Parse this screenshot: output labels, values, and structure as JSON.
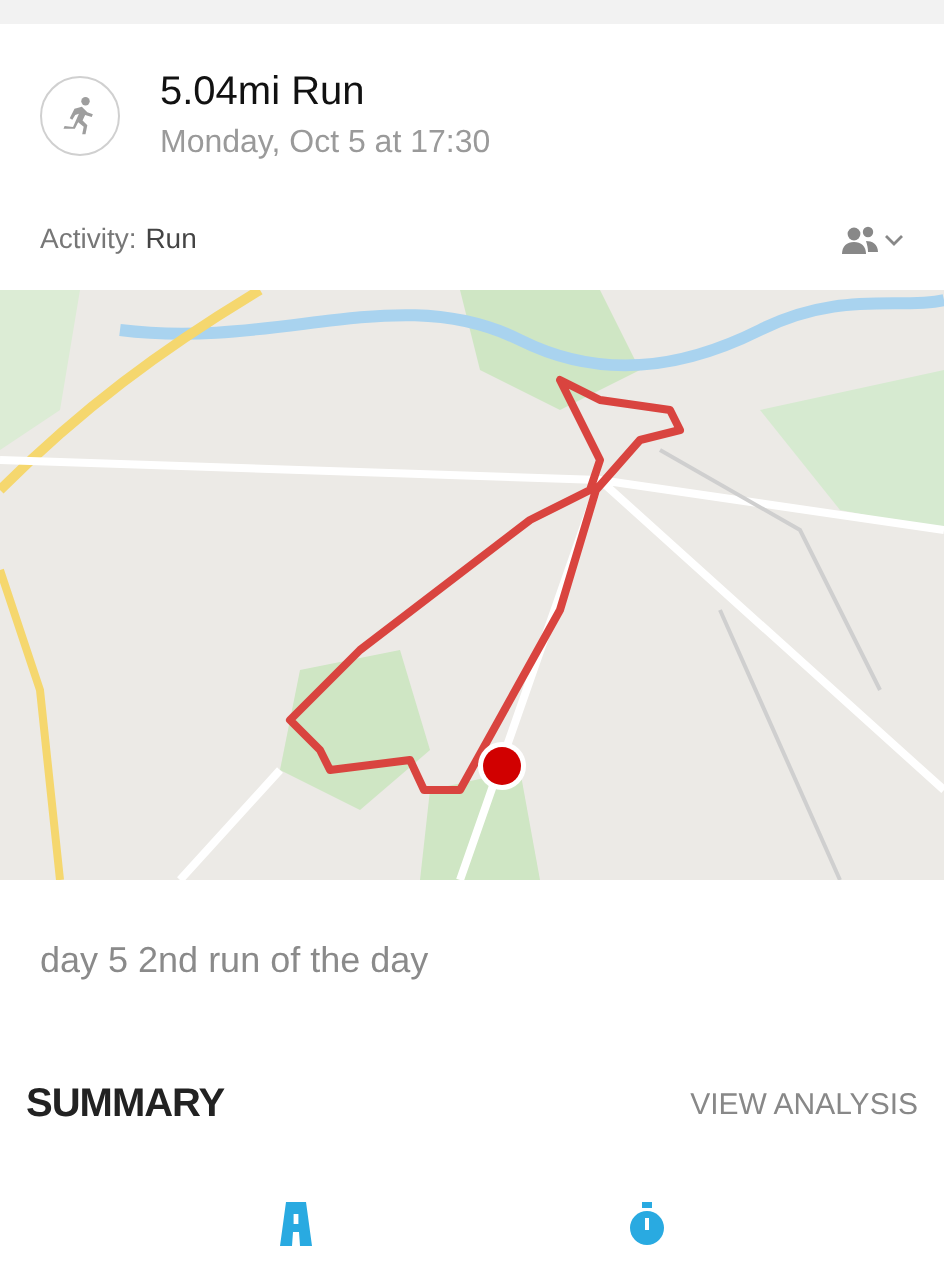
{
  "activity": {
    "title": "5.04mi Run",
    "subtitle": "Monday, Oct 5 at 17:30"
  },
  "activity_type": {
    "label": "Activity:",
    "value": "Run"
  },
  "note": "day 5 2nd run of the day",
  "summary": {
    "title": "SUMMARY",
    "action": "VIEW ANALYSIS"
  }
}
